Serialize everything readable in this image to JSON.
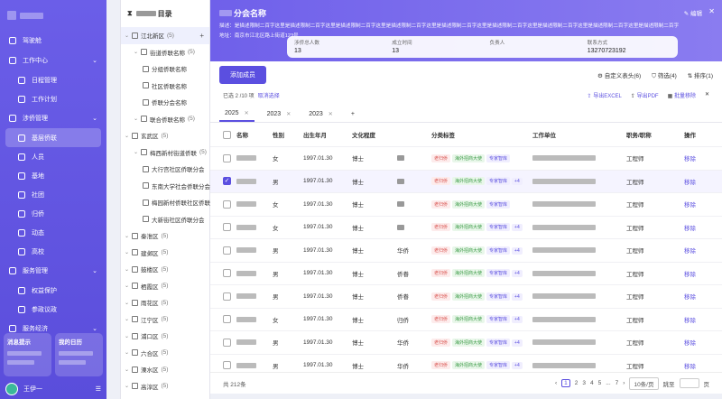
{
  "sidebar": {
    "title": "",
    "items": [
      {
        "label": "驾驶舱",
        "type": "top"
      },
      {
        "label": "工作中心",
        "type": "group"
      },
      {
        "label": "日程管理",
        "type": "sub"
      },
      {
        "label": "工作计划",
        "type": "sub"
      },
      {
        "label": "涉侨管理",
        "type": "group"
      },
      {
        "label": "基层侨联",
        "type": "sub",
        "active": true
      },
      {
        "label": "人员",
        "type": "sub"
      },
      {
        "label": "基地",
        "type": "sub"
      },
      {
        "label": "社团",
        "type": "sub"
      },
      {
        "label": "归侨",
        "type": "sub"
      },
      {
        "label": "动态",
        "type": "sub"
      },
      {
        "label": "高校",
        "type": "sub"
      },
      {
        "label": "服务管理",
        "type": "group"
      },
      {
        "label": "权益保护",
        "type": "sub"
      },
      {
        "label": "参政议政",
        "type": "sub"
      },
      {
        "label": "服务经济",
        "type": "group"
      }
    ],
    "cards": [
      {
        "label": "消息提示"
      },
      {
        "label": "我的日历"
      }
    ],
    "user": "王伊一"
  },
  "tree": {
    "title": "目录",
    "rows": [
      {
        "label": "江北新区",
        "count": "(5)",
        "level": 0,
        "sel": true,
        "add": "+"
      },
      {
        "label": "街道侨联名称",
        "count": "(5)",
        "level": 1
      },
      {
        "label": "分组侨联名称",
        "count": "",
        "level": 2
      },
      {
        "label": "社区侨联名称",
        "count": "",
        "level": 2
      },
      {
        "label": "侨联分会名称",
        "count": "",
        "level": 2
      },
      {
        "label": "联合侨联名称",
        "count": "(5)",
        "level": 1
      },
      {
        "label": "玄武区",
        "count": "(5)",
        "level": 0
      },
      {
        "label": "梅西新村街道侨联",
        "count": "(5)",
        "level": 1
      },
      {
        "label": "大行宫社区侨联分会",
        "count": "",
        "level": 2
      },
      {
        "label": "东南大学社会侨联分会",
        "count": "",
        "level": 2
      },
      {
        "label": "梅园新村侨联社区侨联",
        "count": "",
        "level": 2
      },
      {
        "label": "大新街社区侨联分会",
        "count": "",
        "level": 2
      },
      {
        "label": "秦淮区",
        "count": "(5)",
        "level": 0
      },
      {
        "label": "建邺区",
        "count": "(5)",
        "level": 0
      },
      {
        "label": "鼓楼区",
        "count": "(5)",
        "level": 0
      },
      {
        "label": "栖霞区",
        "count": "(5)",
        "level": 0
      },
      {
        "label": "雨花区",
        "count": "(5)",
        "level": 0
      },
      {
        "label": "江宁区",
        "count": "(5)",
        "level": 0
      },
      {
        "label": "浦口区",
        "count": "(5)",
        "level": 0
      },
      {
        "label": "六合区",
        "count": "(5)",
        "level": 0
      },
      {
        "label": "溧水区",
        "count": "(5)",
        "level": 0
      },
      {
        "label": "高淳区",
        "count": "(5)",
        "level": 0
      }
    ]
  },
  "banner": {
    "title": "分会名称",
    "desc": "描述：是描述限制二百字这里是描述限制二百字这里是描述限制二百字这里是描述限制二百字这里是描述限制二百字这里是描述限制二百字这里是描述限制二百字这里是描述限制二百字这里是描述限制二百字",
    "addr": "地址：南京市江北区路上街道123号",
    "edit": "编辑",
    "stats": [
      {
        "label": "涉侨总人数",
        "value": "13"
      },
      {
        "label": "成立时间",
        "value": "13"
      },
      {
        "label": "负责人",
        "value": ""
      },
      {
        "label": "联系方式",
        "value": "13270723192"
      }
    ]
  },
  "toolbar": {
    "add": "添加成员",
    "custom": "自定义表头(6)",
    "filter": "筛选(4)",
    "sort": "排序(1)"
  },
  "selbar": {
    "text": "已选 2 /10 项",
    "clear": "取消选择",
    "export_excel": "导出EXCEL",
    "export_pdf": "导出PDF",
    "batch_remove": "批量移除"
  },
  "tabs": [
    {
      "label": "2025"
    },
    {
      "label": "2023"
    },
    {
      "label": "2023"
    }
  ],
  "table": {
    "headers": [
      "名称",
      "性别",
      "出生年月",
      "文化程度",
      "",
      "分类标签",
      "工作单位",
      "职务/职称",
      "操作"
    ],
    "rows": [
      {
        "gender": "女",
        "birth": "1997.01.30",
        "edu": "博士",
        "x": "",
        "extra": false,
        "title": "工程师",
        "checked": false
      },
      {
        "gender": "男",
        "birth": "1997.01.30",
        "edu": "博士",
        "x": "",
        "extra": true,
        "title": "工程师",
        "checked": true
      },
      {
        "gender": "女",
        "birth": "1997.01.30",
        "edu": "博士",
        "x": "",
        "extra": false,
        "title": "工程师",
        "checked": false
      },
      {
        "gender": "女",
        "birth": "1997.01.30",
        "edu": "博士",
        "x": "",
        "extra": true,
        "title": "工程师",
        "checked": false
      },
      {
        "gender": "男",
        "birth": "1997.01.30",
        "edu": "博士",
        "x": "华侨",
        "extra": true,
        "title": "工程师",
        "checked": false
      },
      {
        "gender": "男",
        "birth": "1997.01.30",
        "edu": "博士",
        "x": "侨眷",
        "extra": true,
        "title": "工程师",
        "checked": false
      },
      {
        "gender": "男",
        "birth": "1997.01.30",
        "edu": "博士",
        "x": "侨眷",
        "extra": true,
        "title": "工程师",
        "checked": false
      },
      {
        "gender": "女",
        "birth": "1997.01.30",
        "edu": "博士",
        "x": "归侨",
        "extra": true,
        "title": "工程师",
        "checked": false
      },
      {
        "gender": "男",
        "birth": "1997.01.30",
        "edu": "博士",
        "x": "华侨",
        "extra": true,
        "title": "工程师",
        "checked": false
      },
      {
        "gender": "男",
        "birth": "1997.01.30",
        "edu": "博士",
        "x": "华侨",
        "extra": true,
        "title": "工程师",
        "checked": false
      }
    ],
    "tags": [
      "老归侨",
      "海外招商大使",
      "专家智库"
    ],
    "more": "+4",
    "remove": "移除"
  },
  "pager": {
    "total": "共 212条",
    "pages": [
      "1",
      "2",
      "3",
      "4",
      "5",
      "...",
      "7"
    ],
    "size": "10条/页",
    "jump": "跳至",
    "unit": "页"
  },
  "colors": {
    "accent": "#5b4fe0"
  }
}
